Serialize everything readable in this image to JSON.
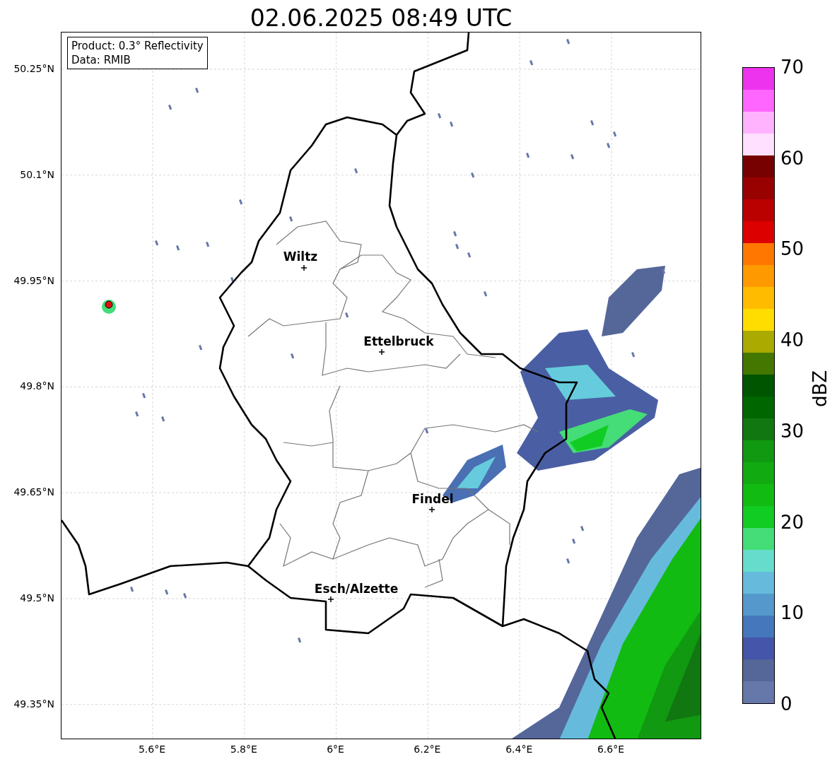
{
  "title": "02.06.2025 08:49 UTC",
  "legend": [
    "Product: 0.3° Reflectivity",
    "Data: RMIB"
  ],
  "map": {
    "x_ticks": [
      "5.6°E",
      "5.8°E",
      "6°E",
      "6.2°E",
      "6.4°E",
      "6.6°E"
    ],
    "y_ticks": [
      "50.25°N",
      "50.1°N",
      "49.95°N",
      "49.8°N",
      "49.65°N",
      "49.5°N",
      "49.35°N"
    ],
    "cities": [
      {
        "name": "Wiltz"
      },
      {
        "name": "Ettelbruck"
      },
      {
        "name": "Findel"
      },
      {
        "name": "Esch/Alzette"
      }
    ]
  },
  "colorbar": {
    "label": "dBZ",
    "ticks": [
      "70",
      "60",
      "50",
      "40",
      "30",
      "20",
      "10",
      "0"
    ],
    "bins": [
      {
        "color": "#ee33ee"
      },
      {
        "color": "#ff66ff"
      },
      {
        "color": "#ffb3ff"
      },
      {
        "color": "#ffe0ff"
      },
      {
        "color": "#770000"
      },
      {
        "color": "#990000"
      },
      {
        "color": "#bb0000"
      },
      {
        "color": "#dd0000"
      },
      {
        "color": "#ff7700"
      },
      {
        "color": "#ff9900"
      },
      {
        "color": "#ffbb00"
      },
      {
        "color": "#ffdd00"
      },
      {
        "color": "#aaaa00"
      },
      {
        "color": "#447700"
      },
      {
        "color": "#005500"
      },
      {
        "color": "#006600"
      },
      {
        "color": "#117711"
      },
      {
        "color": "#119911"
      },
      {
        "color": "#11aa11"
      },
      {
        "color": "#11bb11"
      },
      {
        "color": "#11cc22"
      },
      {
        "color": "#44dd77"
      },
      {
        "color": "#66ddcc"
      },
      {
        "color": "#66bbdd"
      },
      {
        "color": "#5599cc"
      },
      {
        "color": "#4477bb"
      },
      {
        "color": "#4455aa"
      },
      {
        "color": "#556699"
      },
      {
        "color": "#6677aa"
      }
    ]
  }
}
